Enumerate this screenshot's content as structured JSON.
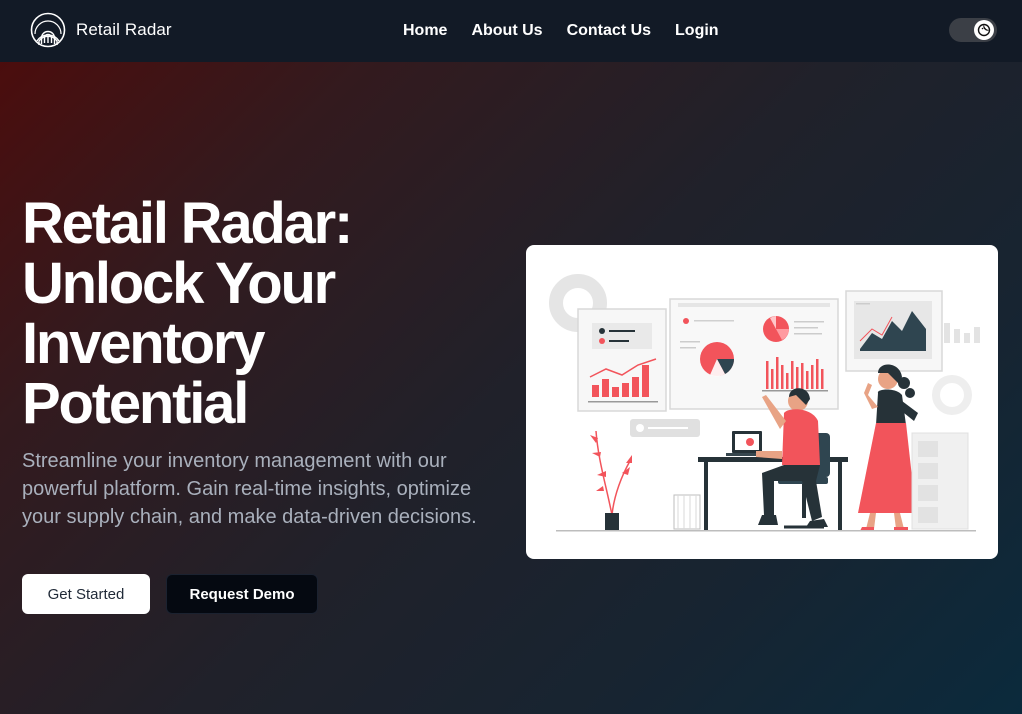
{
  "navbar": {
    "brand_name": "Retail Radar",
    "links": [
      "Home",
      "About Us",
      "Contact Us",
      "Login"
    ],
    "theme_toggle": "moon-icon"
  },
  "hero": {
    "headline_lines": [
      "Retail Radar:",
      "Unlock Your",
      "Inventory",
      "Potential"
    ],
    "subtext": "Streamline your inventory management with our powerful platform. Gain real-time insights, optimize your supply chain, and make data-driven decisions.",
    "primary_button": "Get Started",
    "secondary_button": "Request Demo",
    "illustration": "analytics-dashboard-illustration"
  },
  "colors": {
    "accent_red": "#f2545b",
    "dark_slate": "#2f4550",
    "nav_bg": "#121a26"
  }
}
